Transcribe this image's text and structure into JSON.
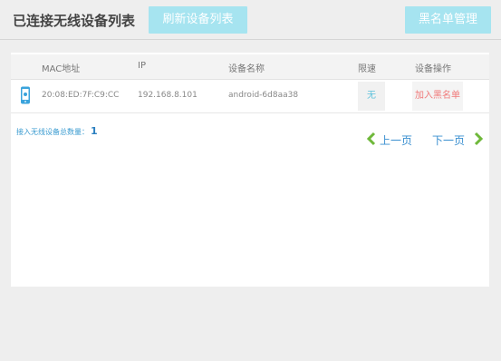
{
  "header": {
    "title": "已连接无线设备列表",
    "refresh_label": "刷新设备列表",
    "blacklist_label": "黑名单管理"
  },
  "table": {
    "columns": [
      "MAC地址",
      "IP",
      "设备名称",
      "限速",
      "设备操作"
    ],
    "rows": [
      {
        "icon": "phone-icon",
        "mac": "20:08:ED:7F:C9:CC",
        "ip": "192.168.8.101",
        "name": "android-6d8aa38",
        "speed": "无",
        "action": "加入黑名单"
      }
    ]
  },
  "footer": {
    "count_label": "接入无线设备总数量：",
    "count_value": "1",
    "prev_label": "上一页",
    "next_label": "下一页"
  },
  "colors": {
    "accent": "#a6e4f0",
    "link": "#3a8fd0",
    "danger": "#f07a7a",
    "chevron": "#6fb83a"
  }
}
